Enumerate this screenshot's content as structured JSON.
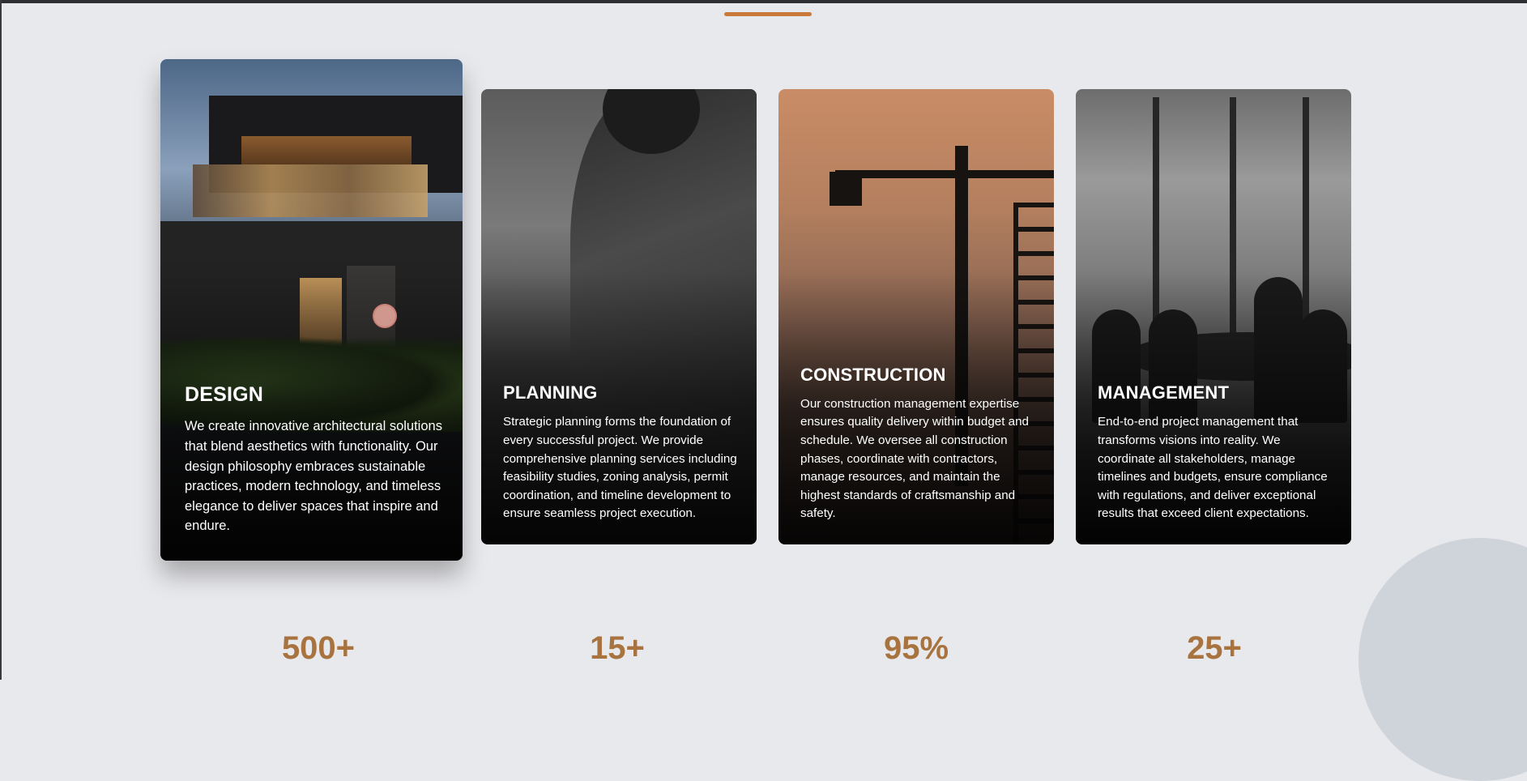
{
  "cards": [
    {
      "title": "DESIGN",
      "text": "We create innovative architectural solutions that blend aesthetics with functionality. Our design philosophy embraces sustainable practices, modern technology, and timeless elegance to deliver spaces that inspire and endure."
    },
    {
      "title": "PLANNING",
      "text": "Strategic planning forms the foundation of every successful project. We provide comprehensive planning services including feasibility studies, zoning analysis, permit coordination, and timeline development to ensure seamless project execution."
    },
    {
      "title": "CONSTRUCTION",
      "text": "Our construction management expertise ensures quality delivery within budget and schedule. We oversee all construction phases, coordinate with contractors, manage resources, and maintain the highest standards of craftsmanship and safety."
    },
    {
      "title": "MANAGEMENT",
      "text": "End-to-end project management that transforms visions into reality. We coordinate all stakeholders, manage timelines and budgets, ensure compliance with regulations, and deliver exceptional results that exceed client expectations."
    }
  ],
  "stats": [
    "500+",
    "15+",
    "95%",
    "25+"
  ],
  "colors": {
    "accent": "#c97a3a",
    "stat_text": "#a8733e",
    "page_bg": "#e8e9ec"
  }
}
